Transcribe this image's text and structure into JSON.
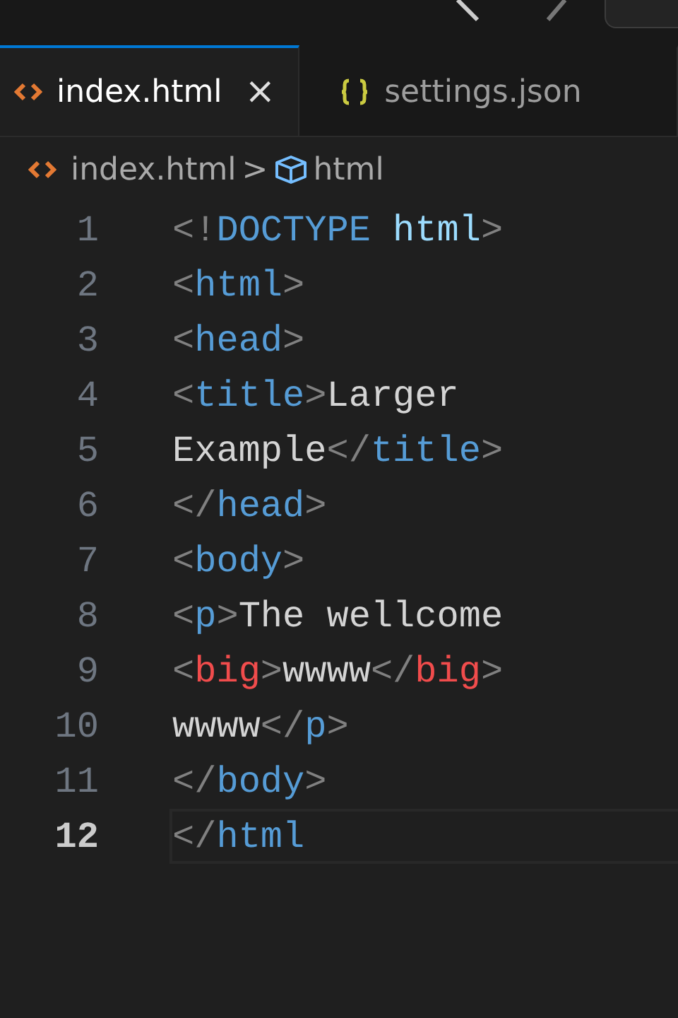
{
  "tabs": [
    {
      "label": "index.html",
      "kind": "html",
      "selected": true,
      "close": "×"
    },
    {
      "label": "settings.json",
      "kind": "json",
      "selected": false
    }
  ],
  "breadcrumb": {
    "file": "index.html",
    "separator": ">",
    "symbol": "html"
  },
  "lines": [
    {
      "number": "1",
      "current": false,
      "tokens": [
        {
          "kind": "punct",
          "text": "<!"
        },
        {
          "kind": "tag",
          "text": "DOCTYPE"
        },
        {
          "kind": "attr",
          "text": " html"
        },
        {
          "kind": "punct",
          "text": ">"
        }
      ]
    },
    {
      "number": "2",
      "current": false,
      "tokens": [
        {
          "kind": "punct",
          "text": "<"
        },
        {
          "kind": "tag",
          "text": "html"
        },
        {
          "kind": "punct",
          "text": ">"
        }
      ]
    },
    {
      "number": "3",
      "current": false,
      "tokens": [
        {
          "kind": "punct",
          "text": "<"
        },
        {
          "kind": "tag",
          "text": "head"
        },
        {
          "kind": "punct",
          "text": ">"
        }
      ]
    },
    {
      "number": "4",
      "current": false,
      "tokens": [
        {
          "kind": "punct",
          "text": "<"
        },
        {
          "kind": "tag",
          "text": "title"
        },
        {
          "kind": "punct",
          "text": ">"
        },
        {
          "kind": "text",
          "text": "Larger"
        }
      ]
    },
    {
      "number": "5",
      "current": false,
      "tokens": [
        {
          "kind": "text",
          "text": "Example"
        },
        {
          "kind": "punct",
          "text": "</"
        },
        {
          "kind": "tag",
          "text": "title"
        },
        {
          "kind": "punct",
          "text": ">"
        }
      ]
    },
    {
      "number": "6",
      "current": false,
      "tokens": [
        {
          "kind": "punct",
          "text": "</"
        },
        {
          "kind": "tag",
          "text": "head"
        },
        {
          "kind": "punct",
          "text": ">"
        }
      ]
    },
    {
      "number": "7",
      "current": false,
      "tokens": [
        {
          "kind": "punct",
          "text": "<"
        },
        {
          "kind": "tag",
          "text": "body"
        },
        {
          "kind": "punct",
          "text": ">"
        }
      ]
    },
    {
      "number": "8",
      "current": false,
      "tokens": [
        {
          "kind": "punct",
          "text": "<"
        },
        {
          "kind": "tag",
          "text": "p"
        },
        {
          "kind": "punct",
          "text": ">"
        },
        {
          "kind": "text",
          "text": "The wellcome"
        }
      ]
    },
    {
      "number": "9",
      "current": false,
      "tokens": [
        {
          "kind": "punct",
          "text": "<"
        },
        {
          "kind": "deprecated",
          "text": "big"
        },
        {
          "kind": "punct",
          "text": ">"
        },
        {
          "kind": "text",
          "text": "wwww"
        },
        {
          "kind": "punct",
          "text": "</"
        },
        {
          "kind": "deprecated",
          "text": "big"
        },
        {
          "kind": "punct",
          "text": ">"
        }
      ]
    },
    {
      "number": "10",
      "current": false,
      "tokens": [
        {
          "kind": "text",
          "text": "wwww"
        },
        {
          "kind": "punct",
          "text": "</"
        },
        {
          "kind": "tag",
          "text": "p"
        },
        {
          "kind": "punct",
          "text": ">"
        }
      ]
    },
    {
      "number": "11",
      "current": false,
      "tokens": [
        {
          "kind": "punct",
          "text": "</"
        },
        {
          "kind": "tag",
          "text": "body"
        },
        {
          "kind": "punct",
          "text": ">"
        }
      ]
    },
    {
      "number": "12",
      "current": true,
      "tokens": [
        {
          "kind": "punct",
          "text": "</"
        },
        {
          "kind": "tag",
          "text": "html"
        }
      ]
    }
  ]
}
